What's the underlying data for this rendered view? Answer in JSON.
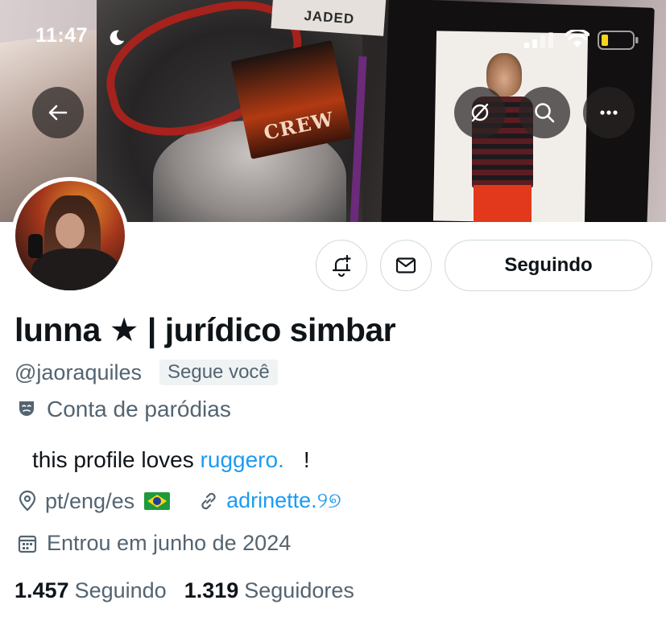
{
  "status_bar": {
    "time": "11:47",
    "icons": [
      "moon-icon",
      "signal-icon",
      "wifi-icon",
      "battery-icon"
    ]
  },
  "header": {
    "buttons": [
      "back-arrow-icon",
      "grok-icon",
      "search-icon",
      "more-icon"
    ],
    "banner_text": {
      "card": "CREW",
      "book": "JADED"
    }
  },
  "actions": {
    "notify_icon": "bell-plus-icon",
    "message_icon": "envelope-icon",
    "following_label": "Seguindo"
  },
  "profile": {
    "display_name": "lunna ★ | jurídico simbar",
    "handle": "@jaoraquiles",
    "follows_you": "Segue você",
    "parody_label": "Conta de paródias",
    "bio_prefix": "this profile loves",
    "bio_mention": "ruggero.",
    "bio_suffix": "!",
    "location": "pt/eng/es",
    "link": "adrinette.୨୭",
    "joined": "Entrou em junho de 2024"
  },
  "stats": {
    "following_count": "1.457",
    "following_label": "Seguindo",
    "followers_count": "1.319",
    "followers_label": "Seguidores"
  },
  "colors": {
    "accent": "#1d9bf0",
    "secondary_text": "#536471",
    "primary_text": "#0f1419",
    "border": "#cfd9de"
  }
}
